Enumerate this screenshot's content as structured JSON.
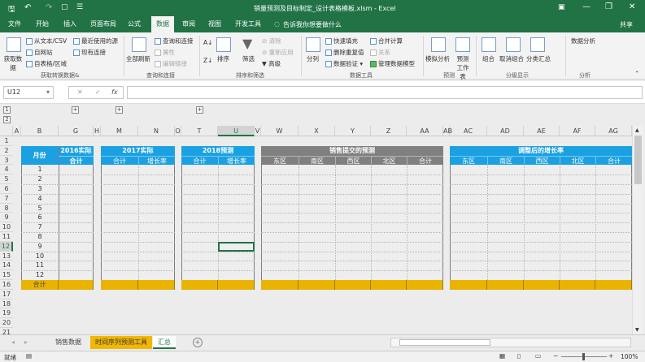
{
  "window": {
    "title": "销量预测及目标制定_设计表格模板.xlsm - Excel",
    "quick_access": [
      "save-icon",
      "undo-icon",
      "redo-icon",
      "print-preview-icon",
      "touch-mode-icon"
    ],
    "controls": [
      "ribbon-display-icon",
      "minimize-icon",
      "restore-icon",
      "close-icon"
    ]
  },
  "tabs": [
    {
      "label": "文件"
    },
    {
      "label": "开始"
    },
    {
      "label": "插入"
    },
    {
      "label": "页面布局"
    },
    {
      "label": "公式"
    },
    {
      "label": "数据",
      "active": true
    },
    {
      "label": "审阅"
    },
    {
      "label": "视图"
    },
    {
      "label": "开发工具"
    }
  ],
  "tell_me": "告诉我你想要做什么",
  "share": "共享",
  "ribbon": {
    "groups": [
      {
        "label": "获取转换数据&",
        "items": [
          "获取数据",
          "从文本/CSV",
          "自网站",
          "自表格/区域",
          "最近使用的源",
          "现有连接"
        ]
      },
      {
        "label": "查询和连接",
        "items": [
          "全部刷新",
          "查询和连接",
          "属性",
          "编辑链接"
        ]
      },
      {
        "label": "排序和筛选",
        "items": [
          "排序",
          "筛选",
          "清除",
          "重新应用",
          "高级"
        ]
      },
      {
        "label": "数据工具",
        "items": [
          "分列",
          "快速填充",
          "删除重复值",
          "数据验证",
          "合并计算",
          "关系",
          "管理数据模型"
        ]
      },
      {
        "label": "预测",
        "items": [
          "模拟分析",
          "预测工作表"
        ]
      },
      {
        "label": "分级显示",
        "items": [
          "组合",
          "取消组合",
          "分类汇总"
        ]
      },
      {
        "label": "分析",
        "items": [
          "数据分析"
        ]
      }
    ]
  },
  "formula_bar": {
    "name_box": "U12",
    "cancel": "✕",
    "enter": "✓",
    "fx": "fx",
    "value": ""
  },
  "outline": {
    "levels": [
      "1",
      "2"
    ],
    "expand": "+"
  },
  "columns": [
    "A",
    "B",
    "G",
    "H",
    "M",
    "N",
    "O",
    "T",
    "U",
    "V",
    "W",
    "X",
    "Y",
    "Z",
    "AA",
    "AB",
    "AC",
    "AD",
    "AE",
    "AF",
    "AG"
  ],
  "selected_column": "U",
  "rows": [
    "1",
    "2",
    "3",
    "4",
    "5",
    "6",
    "7",
    "8",
    "9",
    "10",
    "11",
    "12",
    "13",
    "14",
    "15",
    "16",
    "17",
    "18",
    "19",
    "20",
    "21"
  ],
  "selected_row": "12",
  "tables": [
    {
      "title": "月份",
      "sub": [
        "2016实际",
        "合计"
      ],
      "months": [
        "1",
        "2",
        "3",
        "4",
        "5",
        "6",
        "7",
        "8",
        "9",
        "10",
        "11",
        "12"
      ],
      "total": "合计"
    },
    {
      "title": "2017实际",
      "cols": [
        "合计",
        "增长率"
      ]
    },
    {
      "title": "2018预测",
      "cols": [
        "合计",
        "增长率"
      ]
    },
    {
      "title": "销售提交的预测",
      "cols": [
        "东区",
        "南区",
        "西区",
        "北区",
        "合计"
      ]
    },
    {
      "title": "调整后的增长率",
      "cols": [
        "东区",
        "南区",
        "西区",
        "北区",
        "合计"
      ]
    }
  ],
  "colors": {
    "excel_green": "#217346",
    "header_blue": "#1ba1e2",
    "header_gray": "#808080",
    "total_yellow": "#e9b300"
  },
  "sheets": [
    {
      "label": "销售数据"
    },
    {
      "label": "时间序列预测工具",
      "highlight": true
    },
    {
      "label": "汇总",
      "active": true
    }
  ],
  "add_sheet": "+",
  "status": {
    "ready": "就绪",
    "zoom": "100%"
  }
}
